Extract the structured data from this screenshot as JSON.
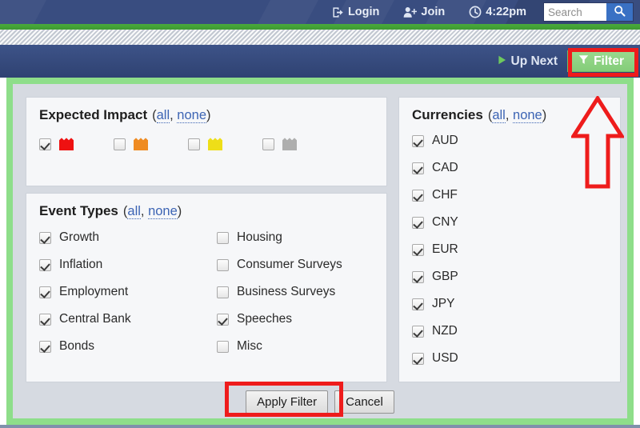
{
  "topbar": {
    "items": [
      {
        "label": "Login",
        "icon": "login-icon"
      },
      {
        "label": "Join",
        "icon": "user-add-icon"
      },
      {
        "label": "4:22pm",
        "icon": "clock-icon"
      }
    ],
    "search": {
      "value": "",
      "placeholder": "Search",
      "button_icon": "search-icon"
    }
  },
  "toolbar": {
    "up_next_label": "Up Next",
    "up_next_icon": "play-icon",
    "filter_label": "Filter",
    "filter_icon": "funnel-icon"
  },
  "filter_panel": {
    "impact": {
      "title": "Expected Impact",
      "all_label": "all",
      "none_label": "none",
      "separator": ", ",
      "open_paren": "(",
      "close_paren": ")",
      "levels": [
        {
          "name": "high-impact",
          "color": "#ee1111",
          "checked": true
        },
        {
          "name": "medium-impact",
          "color": "#ef8b22",
          "checked": false
        },
        {
          "name": "low-impact",
          "color": "#eede18",
          "checked": false
        },
        {
          "name": "non-economic",
          "color": "#aeaeae",
          "checked": false
        }
      ]
    },
    "event_types": {
      "title": "Event Types",
      "all_label": "all",
      "none_label": "none",
      "left_column": [
        {
          "label": "Growth",
          "checked": true
        },
        {
          "label": "Inflation",
          "checked": true
        },
        {
          "label": "Employment",
          "checked": true
        },
        {
          "label": "Central Bank",
          "checked": true
        },
        {
          "label": "Bonds",
          "checked": true
        }
      ],
      "right_column": [
        {
          "label": "Housing",
          "checked": false
        },
        {
          "label": "Consumer Surveys",
          "checked": false
        },
        {
          "label": "Business Surveys",
          "checked": false
        },
        {
          "label": "Speeches",
          "checked": true
        },
        {
          "label": "Misc",
          "checked": false
        }
      ]
    },
    "currencies": {
      "title": "Currencies",
      "all_label": "all",
      "none_label": "none",
      "items": [
        {
          "label": "AUD",
          "checked": true
        },
        {
          "label": "CAD",
          "checked": true
        },
        {
          "label": "CHF",
          "checked": true
        },
        {
          "label": "CNY",
          "checked": true
        },
        {
          "label": "EUR",
          "checked": true
        },
        {
          "label": "GBP",
          "checked": true
        },
        {
          "label": "JPY",
          "checked": true
        },
        {
          "label": "NZD",
          "checked": true
        },
        {
          "label": "USD",
          "checked": true
        }
      ]
    },
    "apply_label": "Apply Filter",
    "cancel_label": "Cancel"
  },
  "annotations": {
    "highlight_color": "#ee1c1c",
    "arrow_direction": "up",
    "highlighted_targets": [
      "filter-button",
      "apply-filter-button"
    ]
  },
  "colors": {
    "header_blue": "#394d80",
    "accent_green": "#3d9a31",
    "panel_border_green": "#8ede8a",
    "filter_button_green": "#8fd384",
    "panel_bg": "#d6dae1",
    "box_bg": "#f6f7f9",
    "link_blue": "#3c64b4"
  }
}
